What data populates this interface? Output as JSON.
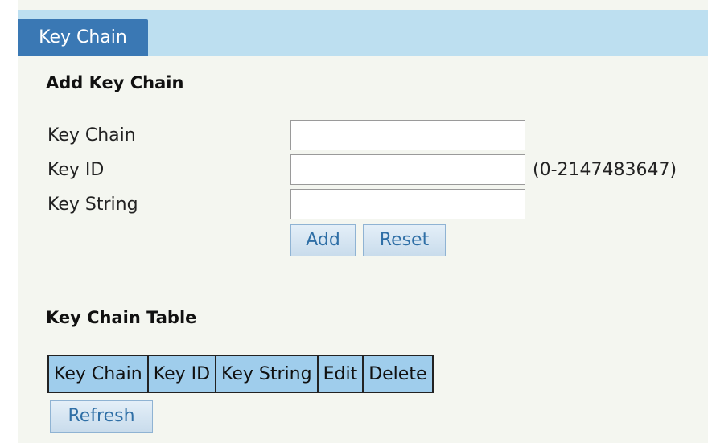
{
  "tab": {
    "label": "Key Chain"
  },
  "add_section": {
    "title": "Add Key Chain",
    "fields": [
      {
        "label": "Key Chain",
        "value": ""
      },
      {
        "label": "Key ID",
        "value": "",
        "hint": "(0-2147483647)"
      },
      {
        "label": "Key String",
        "value": ""
      }
    ],
    "add_label": "Add",
    "reset_label": "Reset"
  },
  "table_section": {
    "title": "Key Chain Table",
    "columns": [
      "Key Chain",
      "Key ID",
      "Key String",
      "Edit",
      "Delete"
    ],
    "rows": [],
    "refresh_label": "Refresh"
  },
  "colors": {
    "tab_bar": "#bddff0",
    "tab_active": "#3a78b4",
    "panel_background": "#f4f6f0",
    "table_header": "#9fcdec",
    "button_text": "#2f6fa6"
  }
}
